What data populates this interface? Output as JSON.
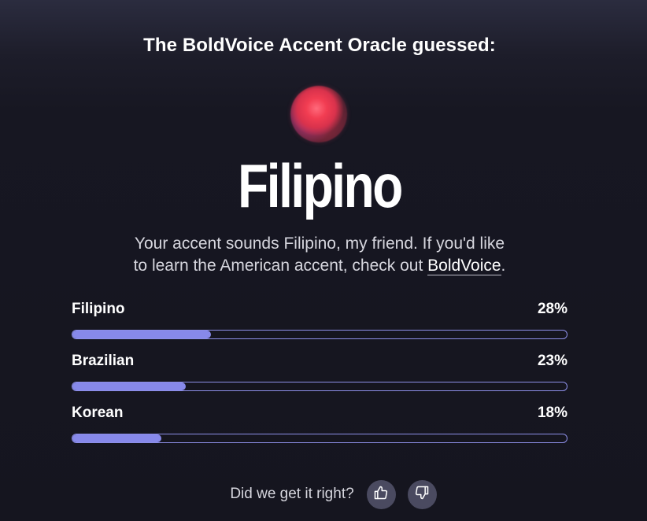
{
  "heading": "The BoldVoice Accent Oracle guessed:",
  "result": "Filipino",
  "subtitle": {
    "line1": "Your accent sounds Filipino, my friend. If you'd like",
    "line2_prefix": "to learn the American accent, check out ",
    "link_text": "BoldVoice",
    "line2_suffix": "."
  },
  "accent_color": "#8789ea",
  "chart_data": {
    "type": "bar",
    "categories": [
      "Filipino",
      "Brazilian",
      "Korean"
    ],
    "values": [
      28,
      23,
      18
    ],
    "labels": [
      "28%",
      "23%",
      "18%"
    ]
  },
  "feedback": {
    "question": "Did we get it right?",
    "thumbs_up_icon": "thumbs-up-icon",
    "thumbs_down_icon": "thumbs-down-icon"
  }
}
